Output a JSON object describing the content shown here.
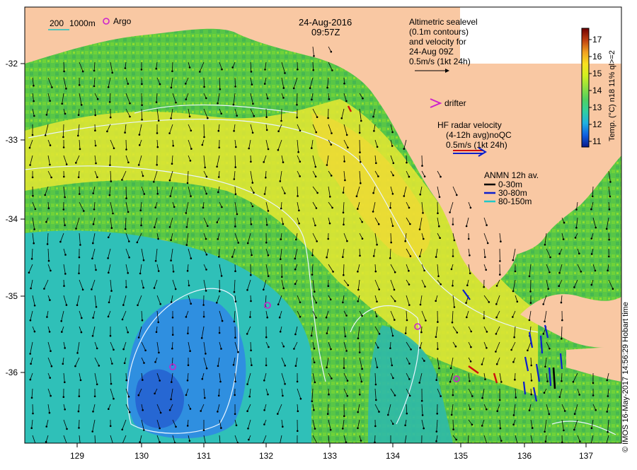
{
  "map": {
    "date": "24-Aug-2016",
    "time": "09:57Z",
    "x_ticks": [
      "129",
      "130",
      "131",
      "132",
      "133",
      "134",
      "135",
      "136",
      "137"
    ],
    "y_ticks": [
      "-32",
      "-33",
      "-34",
      "-35",
      "-36"
    ],
    "colors": {
      "land": "#f9c8a3",
      "frame": "#000000",
      "contour": "#e8f4ff"
    }
  },
  "legend": {
    "depth_labels": {
      "a": "200",
      "b": "1000m"
    },
    "argo_label": "Argo",
    "altimetric": {
      "line1": "Altimetric sealevel",
      "line2": "(0.1m contours)",
      "line3": "and velocity for",
      "line4": "24-Aug 09Z",
      "line5": "0.5m/s (1kt 24h)"
    },
    "drifter_label": "drifter",
    "hf_radar": {
      "line1": "HF radar velocity",
      "line2": "(4-12h avg)noQC",
      "line3": "0.5m/s (1kt 24h)"
    },
    "anmn": {
      "title": "ANMN 12h av.",
      "items": [
        "0-30m",
        "30-80m",
        "80-150m"
      ],
      "colors": [
        "#000000",
        "#0000cc",
        "#00cccc"
      ]
    }
  },
  "colorbar": {
    "ticks": [
      "17",
      "16",
      "15",
      "14",
      "13",
      "12",
      "11"
    ],
    "label": "Temp. (°C) n18 11% ql>=2",
    "colors": [
      "#0a1a8a",
      "#1060e0",
      "#20b0e0",
      "#30d0a0",
      "#50d060",
      "#90e040",
      "#d0f020",
      "#f8e020",
      "#f0a020",
      "#c04010",
      "#700000"
    ]
  },
  "credit": "© IMOS 16-May-2017 14:56:29 Hobart time"
}
